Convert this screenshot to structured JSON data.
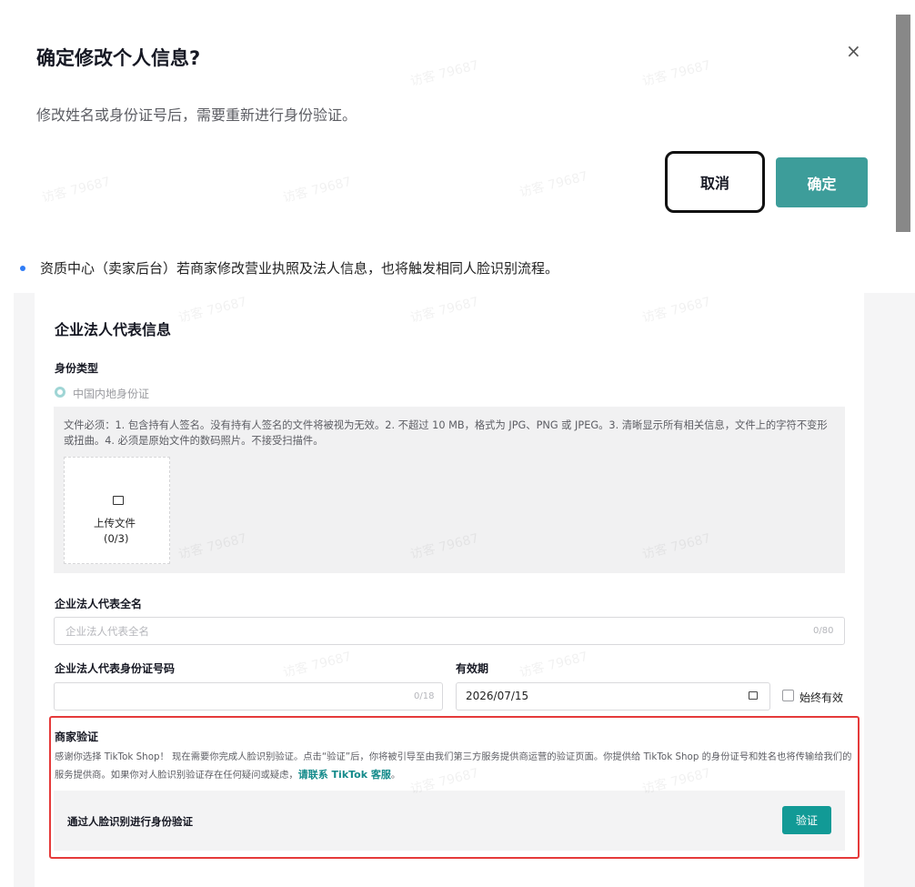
{
  "dialog": {
    "title": "确定修改个人信息?",
    "close_glyph": "×",
    "description": "修改姓名或身份证号后，需要重新进行身份验证。",
    "cancel_label": "取消",
    "confirm_label": "确定"
  },
  "bullet": {
    "text": "资质中心（卖家后台）若商家修改营业执照及法人信息，也将触发相同人脸识别流程。"
  },
  "form": {
    "section_title": "企业法人代表信息",
    "id_type_label": "身份类型",
    "id_type_option": "中国内地身份证",
    "upload_note": "文件必须：1. 包含持有人签名。没有持有人签名的文件将被视为无效。2. 不超过 10 MB，格式为 JPG、PNG 或 JPEG。3. 清晰显示所有相关信息，文件上的字符不变形或扭曲。4. 必须是原始文件的数码照片。不接受扫描件。",
    "upload_label": "上传文件",
    "upload_count": "(0/3)",
    "fullname_label": "企业法人代表全名",
    "fullname_placeholder": "企业法人代表全名",
    "fullname_counter": "0/80",
    "id_number_label": "企业法人代表身份证号码",
    "id_number_value": "",
    "id_number_counter": "0/18",
    "validity_label": "有效期",
    "validity_value": "2026/07/15",
    "always_valid_label": "始终有效"
  },
  "merchant_verification": {
    "title": "商家验证",
    "description": "感谢你选择 TikTok Shop！ 现在需要你完成人脸识别验证。点击“验证”后，你将被引导至由我们第三方服务提供商运营的验证页面。你提供给 TikTok Shop 的身份证号和姓名也将传输给我们的服务提供商。如果你对人脸识别验证存在任何疑问或疑虑，",
    "link_text": "请联系 TikTok 客服",
    "desc_end": "。",
    "row_label": "通过人脸识别进行身份验证",
    "verify_label": "验证"
  },
  "watermark": "访客 79687",
  "colors": {
    "primary_teal": "#3d9d9a",
    "verify_teal": "#129a96",
    "highlight_red": "#e53a3a",
    "bullet_blue": "#2f7cf6"
  }
}
